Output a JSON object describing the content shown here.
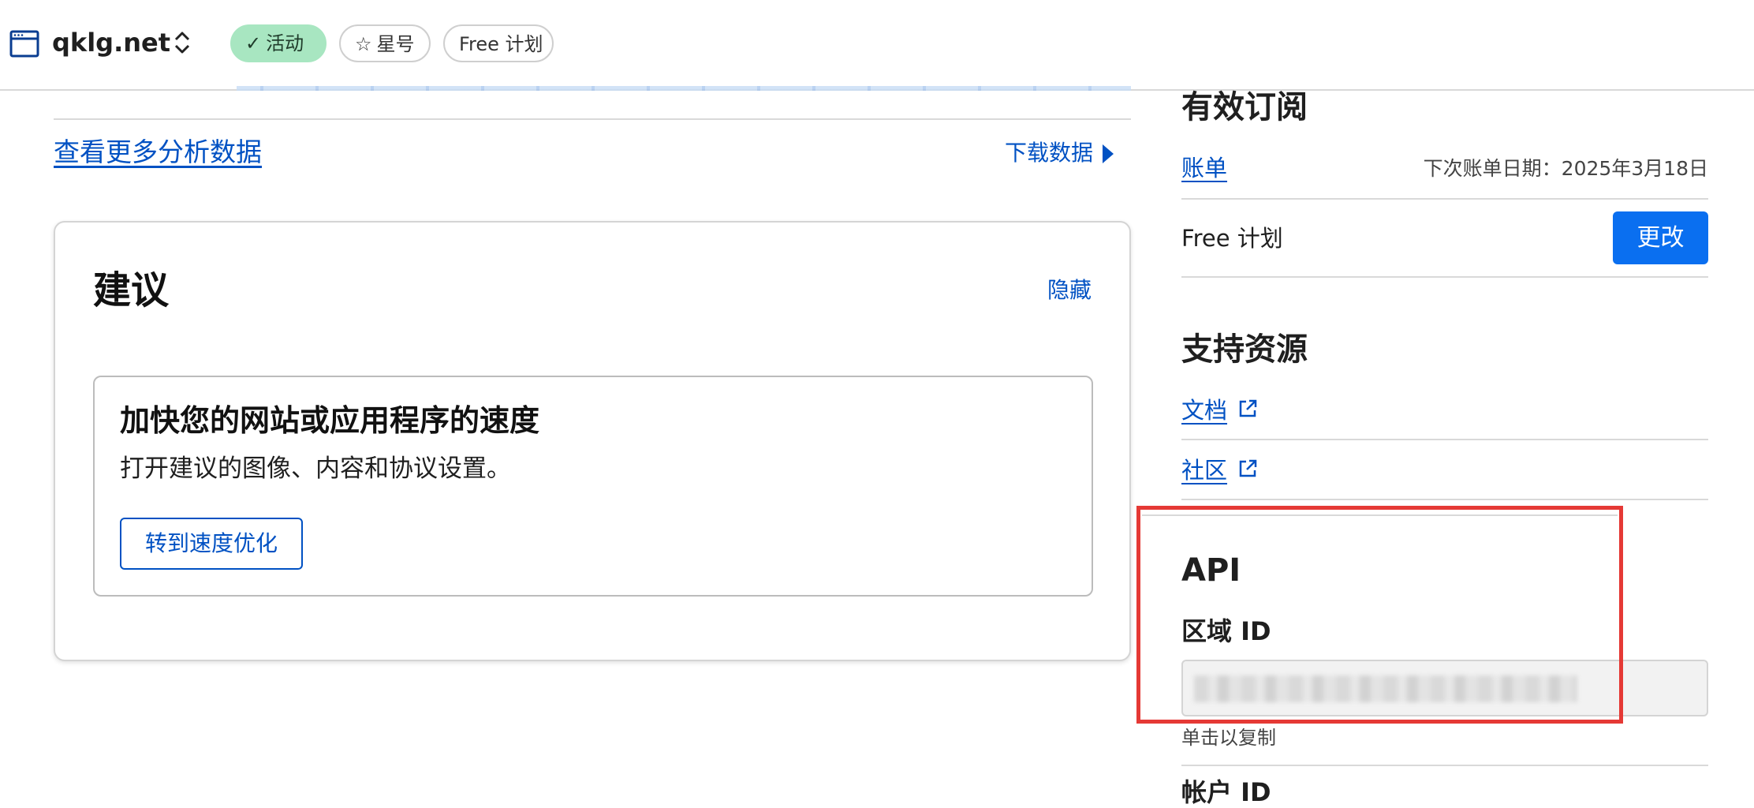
{
  "header": {
    "site_name": "qklg.net",
    "status_badge": "活动",
    "star_label": "星号",
    "plan_badge": "Free 计划"
  },
  "main": {
    "analytics_link": "查看更多分析数据",
    "download_link": "下载数据",
    "recommendations": {
      "title": "建议",
      "hide_label": "隐藏",
      "item": {
        "title": "加快您的网站或应用程序的速度",
        "description": "打开建议的图像、内容和协议设置。",
        "button_label": "转到速度优化"
      }
    }
  },
  "sidebar": {
    "subscription": {
      "heading": "有效订阅",
      "billing_link": "账单",
      "next_bill": "下次账单日期：2025年3月18日",
      "plan_name": "Free 计划",
      "change_button": "更改"
    },
    "support": {
      "heading": "支持资源",
      "docs_link": "文档",
      "community_link": "社区"
    },
    "api": {
      "heading": "API",
      "zone_id_label": "区域 ID",
      "copy_hint": "单击以复制",
      "account_id_label": "帐户 ID"
    }
  },
  "colors": {
    "link": "#0051c3",
    "primary_button": "#0a6ff0",
    "active_badge": "#a8e6c1",
    "highlight": "#e53935"
  },
  "icons": [
    "browser-window-icon",
    "chevron-updown-icon",
    "check-icon",
    "star-outline-icon",
    "caret-right-icon",
    "external-link-icon"
  ]
}
